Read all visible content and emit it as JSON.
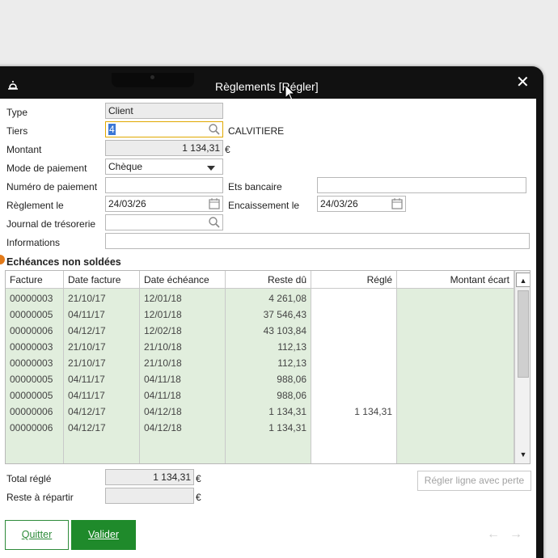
{
  "window": {
    "title": "Règlements [Régler]"
  },
  "form": {
    "type_label": "Type",
    "type_value": "Client",
    "tiers_label": "Tiers",
    "tiers_value": "4",
    "tiers_name": "CALVITIERE",
    "montant_label": "Montant",
    "montant_value": "1 134,31",
    "currency": "€",
    "mode_label": "Mode de paiement",
    "mode_value": "Chèque",
    "numero_label": "Numéro de paiement",
    "numero_value": "",
    "ets_label": "Ets bancaire",
    "ets_value": "",
    "reglement_label": "Règlement le",
    "reglement_value": "24/03/26",
    "encaissement_label": "Encaissement le",
    "encaissement_value": "24/03/26",
    "journal_label": "Journal de trésorerie",
    "journal_value": "",
    "info_label": "Informations",
    "info_value": ""
  },
  "echeances": {
    "title": "Echéances non soldées",
    "columns": [
      "Facture",
      "Date facture",
      "Date échéance",
      "Reste dû",
      "Réglé",
      "Montant écart"
    ],
    "rows": [
      [
        "00000003",
        "21/10/17",
        "12/01/18",
        "4 261,08",
        "",
        ""
      ],
      [
        "00000005",
        "04/11/17",
        "12/01/18",
        "37 546,43",
        "",
        ""
      ],
      [
        "00000006",
        "04/12/17",
        "12/02/18",
        "43 103,84",
        "",
        ""
      ],
      [
        "00000003",
        "21/10/17",
        "21/10/18",
        "112,13",
        "",
        ""
      ],
      [
        "00000003",
        "21/10/17",
        "21/10/18",
        "112,13",
        "",
        ""
      ],
      [
        "00000005",
        "04/11/17",
        "04/11/18",
        "988,06",
        "",
        ""
      ],
      [
        "00000005",
        "04/11/17",
        "04/11/18",
        "988,06",
        "",
        ""
      ],
      [
        "00000006",
        "04/12/17",
        "04/12/18",
        "1 134,31",
        "1 134,31",
        ""
      ],
      [
        "00000006",
        "04/12/17",
        "04/12/18",
        "1 134,31",
        "",
        ""
      ]
    ]
  },
  "totals": {
    "total_label": "Total réglé",
    "total_value": "1 134,31",
    "reste_label": "Reste à répartir",
    "reste_value": "",
    "currency": "€"
  },
  "buttons": {
    "loss": "Régler ligne avec perte",
    "quit": "Quitter",
    "validate": "Valider"
  },
  "icons": {
    "app": "bell-icon",
    "close": "close-icon",
    "search": "search-icon",
    "calendar": "calendar-icon",
    "dropdown": "chevron-down-icon",
    "prev": "arrow-left-icon",
    "next": "arrow-right-icon"
  },
  "colors": {
    "accent_green": "#1f8a2b",
    "row_shade": "#e1eedd",
    "focus_border": "#e0a800",
    "marker_orange": "#e27a1a"
  }
}
